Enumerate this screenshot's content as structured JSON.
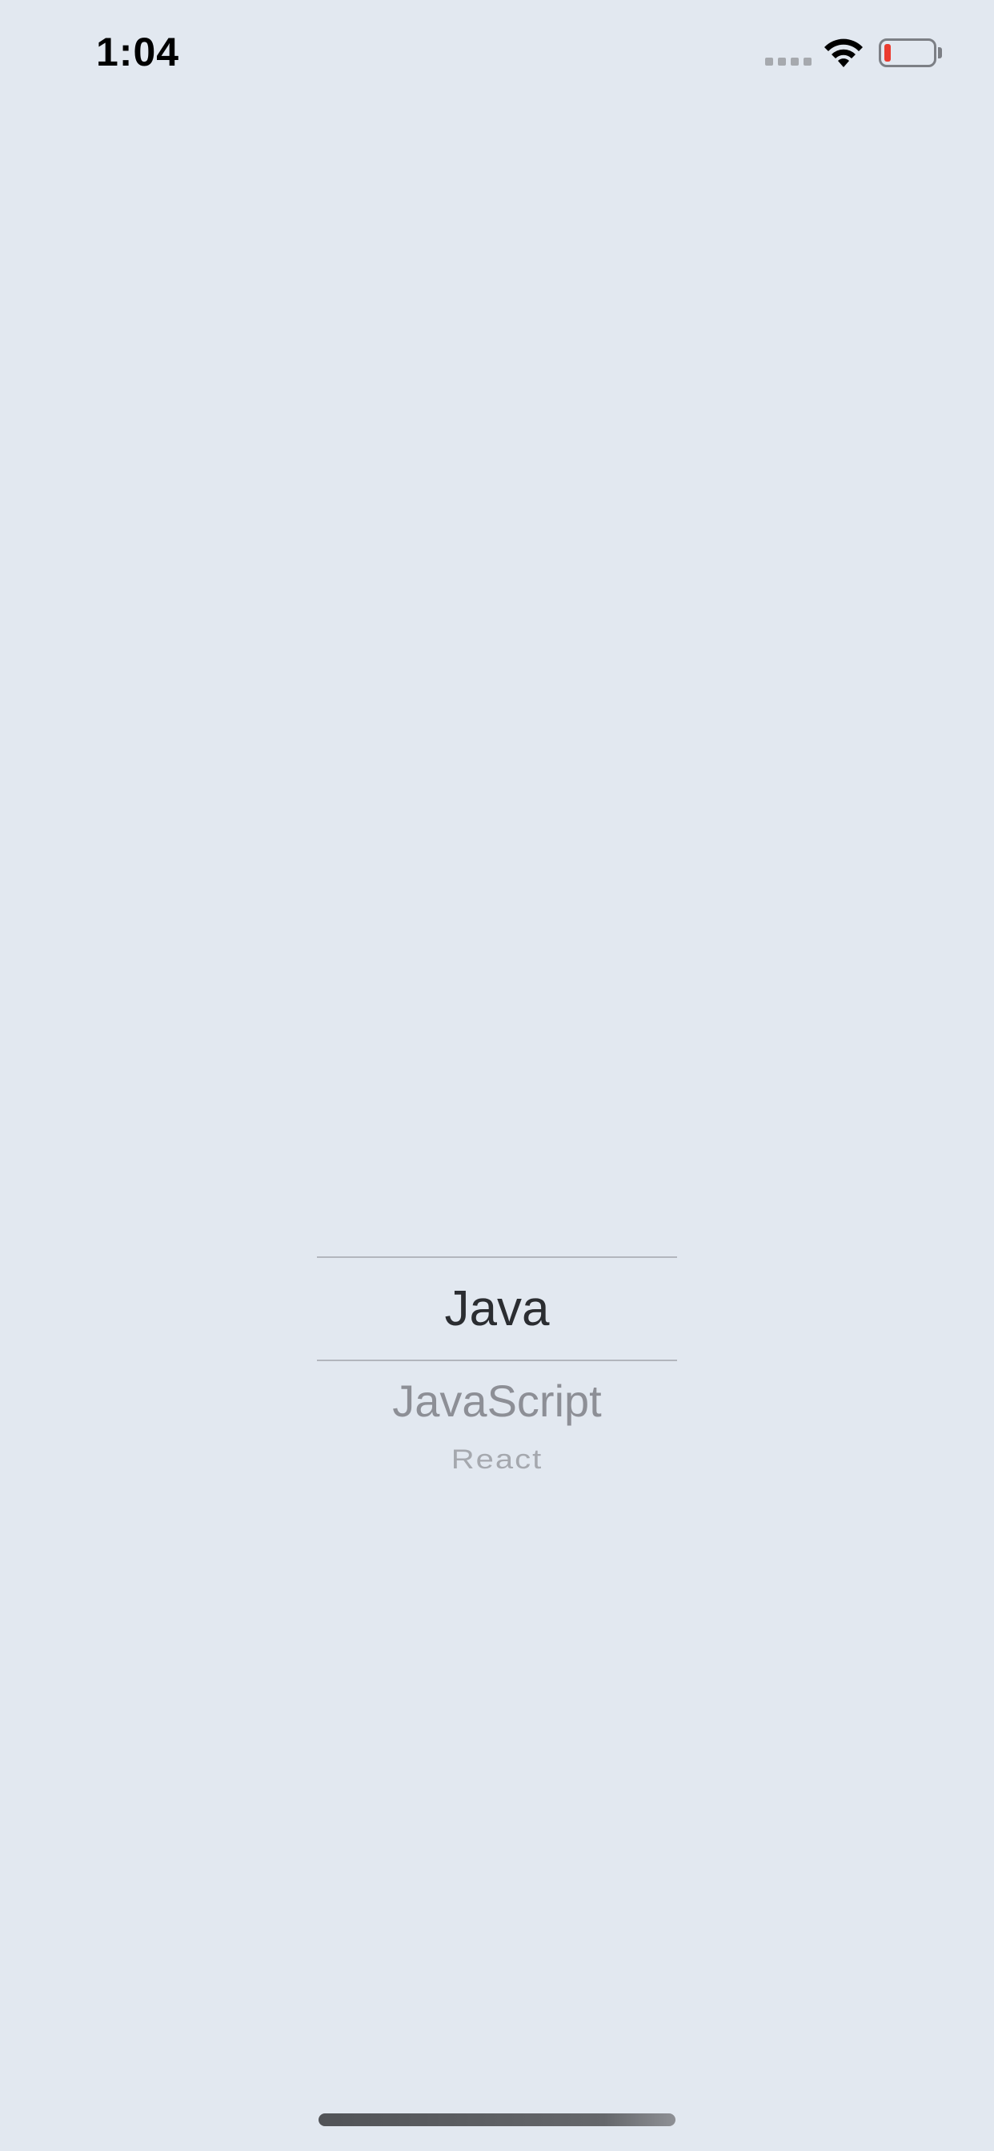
{
  "status_bar": {
    "time": "1:04",
    "signal_icon": "cellular-signal-icon",
    "wifi_icon": "wifi-icon",
    "battery_icon": "battery-low-icon",
    "battery_level_color": "#eb3b2f"
  },
  "picker": {
    "items": [
      "Java",
      "JavaScript",
      "React"
    ],
    "selected": "Java"
  },
  "colors": {
    "background": "#e2e8f0",
    "selected_text": "#2b2d31",
    "unselected_text": "#8d8f96"
  }
}
